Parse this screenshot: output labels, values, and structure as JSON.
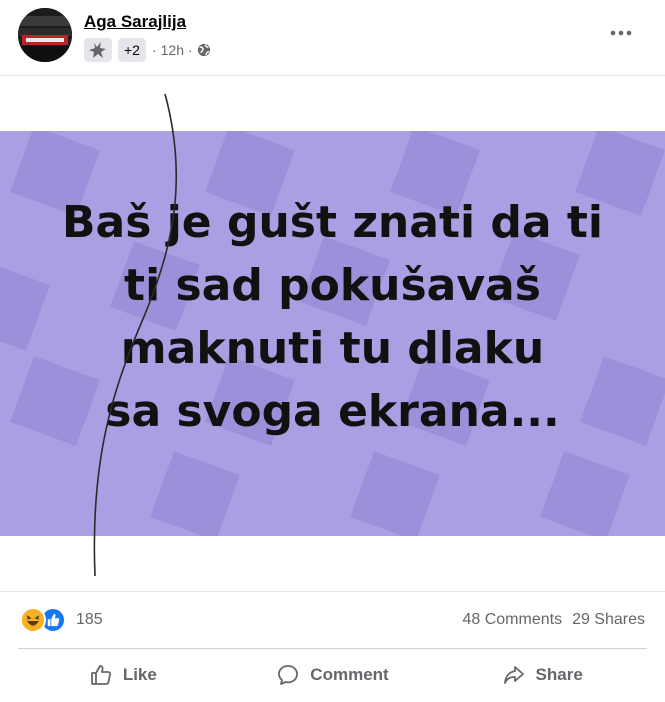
{
  "post": {
    "author_name": "Aga Sarajlija",
    "group_plus": "+2",
    "time": "12h",
    "separator": "·"
  },
  "image_text": {
    "lines": [
      "Baš je gušt znati da ti",
      "ti sad pokušavaš",
      "maknuti tu dlaku",
      "sa svoga ekrana..."
    ]
  },
  "stats": {
    "reaction_count": "185",
    "comments": "48 Comments",
    "shares": "29 Shares"
  },
  "actions": {
    "like": "Like",
    "comment": "Comment",
    "share": "Share"
  },
  "icons": [
    "avatar",
    "group-icon",
    "globe-icon",
    "more-options-icon",
    "haha-reaction-icon",
    "like-reaction-icon",
    "like-icon",
    "comment-icon",
    "share-icon"
  ],
  "colors": {
    "purple_panel": "#ab9fe3",
    "purple_squares": "#9a8ed8",
    "like_blue": "#1877f2",
    "haha_yellow": "#f7b125",
    "secondary_text": "#65676b"
  }
}
